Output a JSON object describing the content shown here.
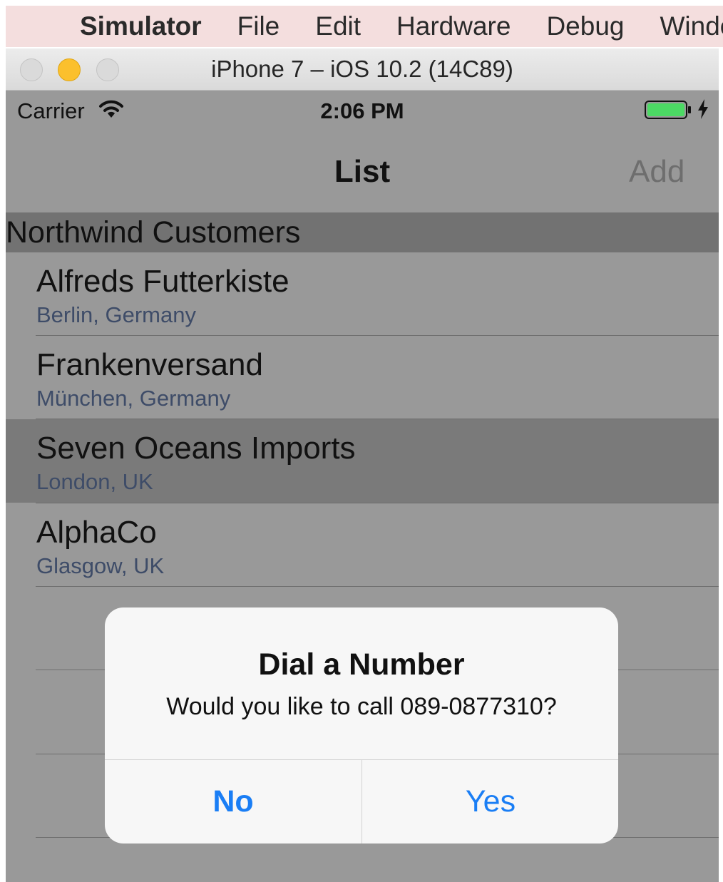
{
  "menubar": {
    "app_name": "Simulator",
    "items": [
      "File",
      "Edit",
      "Hardware",
      "Debug",
      "Window"
    ]
  },
  "window": {
    "title": "iPhone 7 – iOS 10.2 (14C89)"
  },
  "status_bar": {
    "carrier": "Carrier",
    "time": "2:06 PM"
  },
  "nav": {
    "title": "List",
    "add_label": "Add"
  },
  "section": {
    "header": "Northwind Customers"
  },
  "customers": [
    {
      "name": "Alfreds Futterkiste",
      "location": "Berlin, Germany"
    },
    {
      "name": "Frankenversand",
      "location": "München, Germany"
    },
    {
      "name": "Seven Oceans Imports",
      "location": "London, UK",
      "selected": true
    },
    {
      "name": "AlphaCo",
      "location": "Glasgow, UK"
    }
  ],
  "alert": {
    "title": "Dial a Number",
    "message": "Would you like to call 089-0877310?",
    "no_label": "No",
    "yes_label": "Yes"
  },
  "colors": {
    "menubar_bg": "#f4dede",
    "dim_overlay": "#999999",
    "ios_blue": "#1a7ef5",
    "battery_green": "#4cd964"
  },
  "icons": {
    "menubar": "apple-logo-icon",
    "status": [
      "wifi-icon",
      "battery-icon",
      "charging-bolt-icon"
    ]
  }
}
